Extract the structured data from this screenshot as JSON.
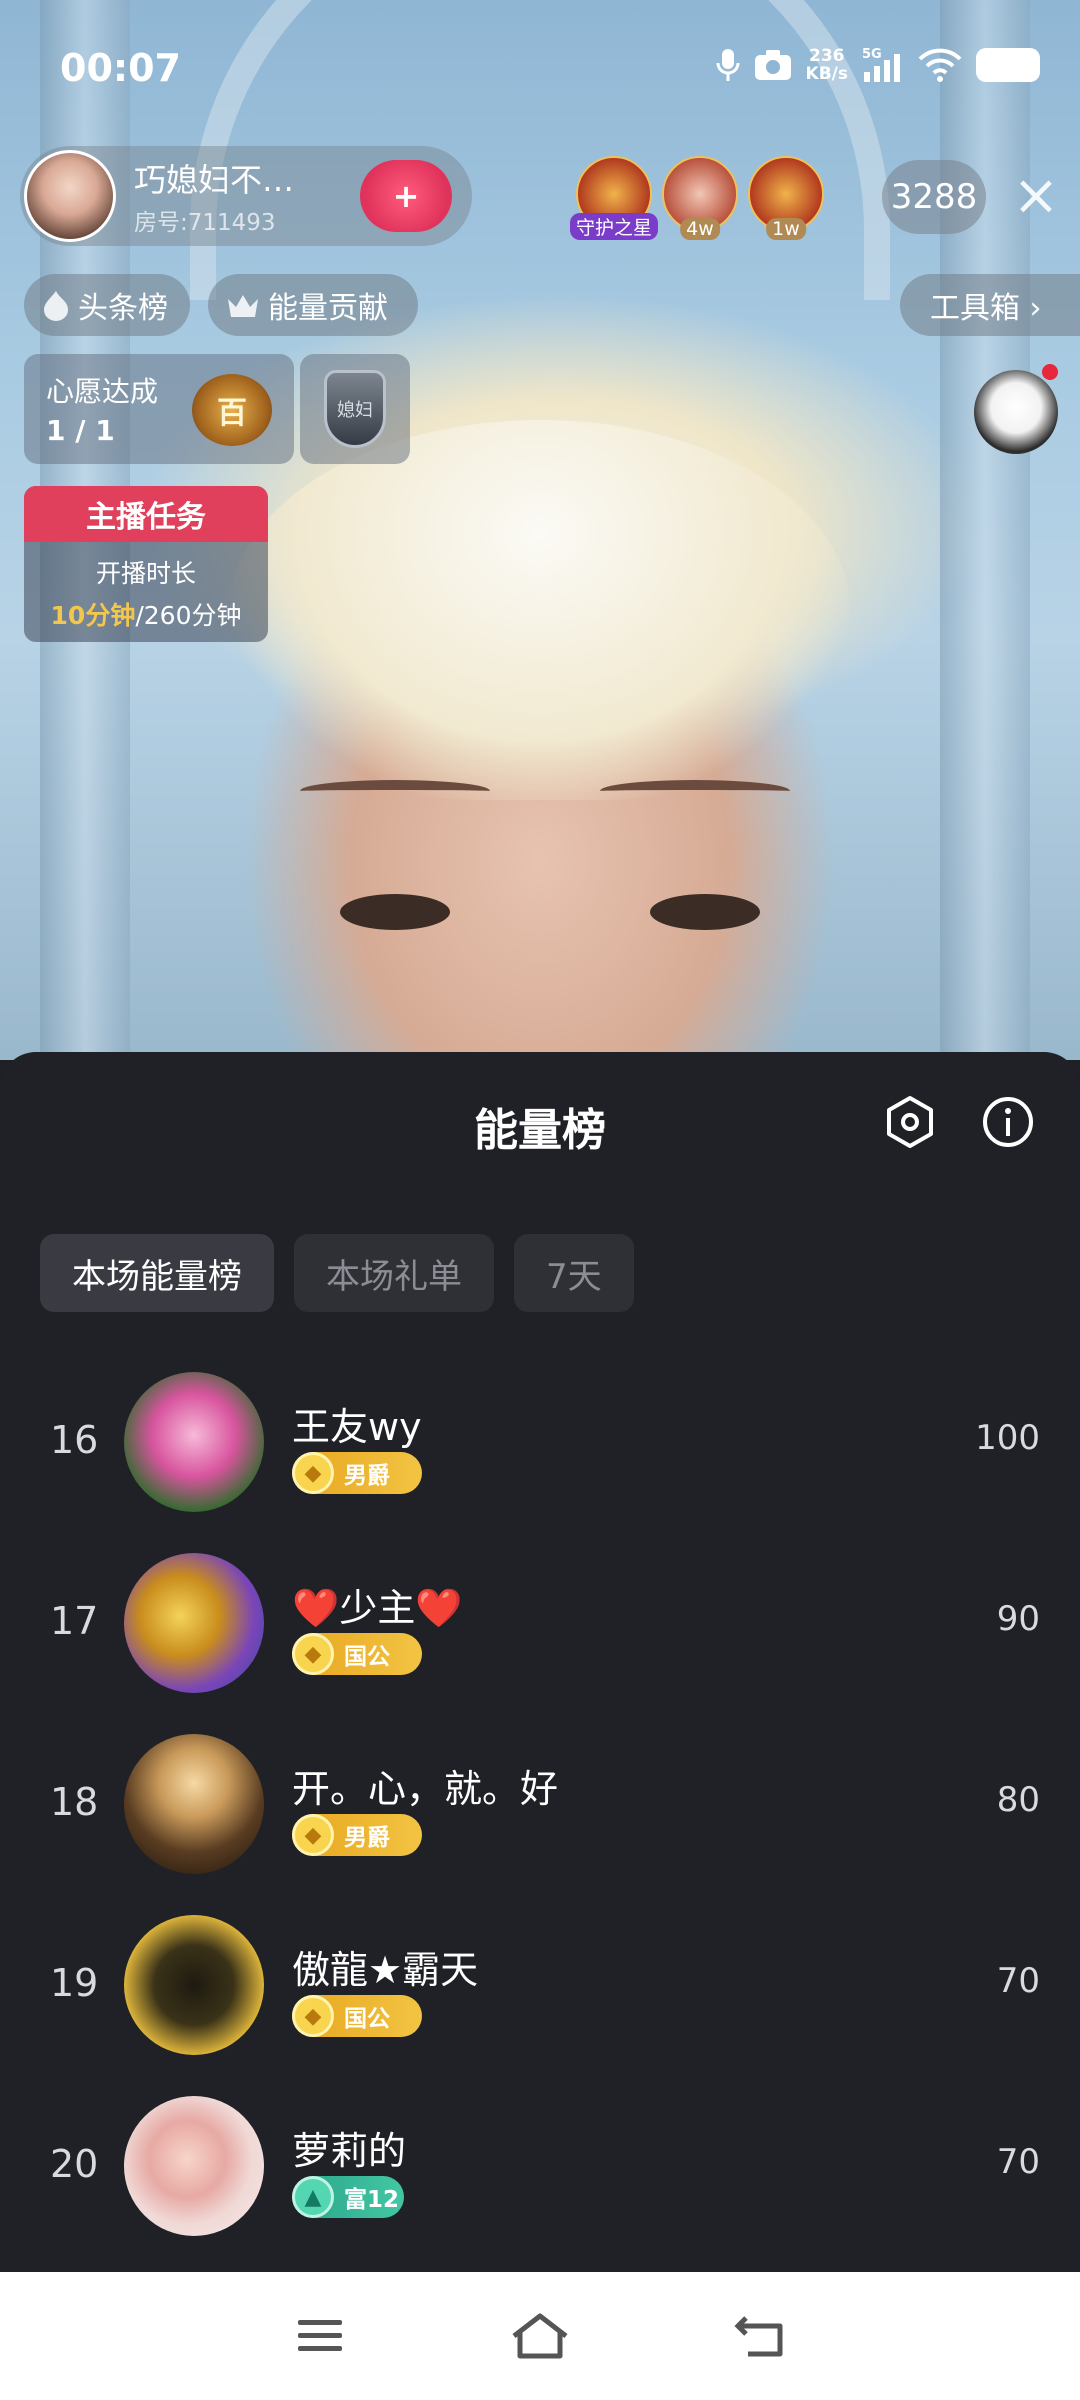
{
  "status_bar": {
    "time": "00:07",
    "net_speed_value": "236",
    "net_speed_unit": "KB/s",
    "network": "5G"
  },
  "host": {
    "name": "巧媳妇不…",
    "room": "房号:711493",
    "follow_label": "+"
  },
  "viewers": [
    {
      "tag": "守护之星",
      "color": "#7b3cc9"
    },
    {
      "tag": "4w",
      "color": "#b08a52"
    },
    {
      "tag": "1w",
      "color": "#b08a52"
    }
  ],
  "viewer_count": "3288",
  "pills": {
    "headline": "头条榜",
    "energy": "能量贡献",
    "toolbox": "工具箱 ›"
  },
  "wish": {
    "title": "心愿达成",
    "progress": "1 / 1",
    "medal": "百"
  },
  "shield_text": "媳妇",
  "task": {
    "title": "主播任务",
    "line1": "开播时长",
    "current": "10分钟",
    "total": "/260分钟"
  },
  "sheet": {
    "title": "能量榜",
    "tabs": [
      "本场能量榜",
      "本场礼单",
      "7天"
    ],
    "active_tab": 0
  },
  "ranks": [
    {
      "rank": "16",
      "name": "王友wy",
      "badge": "男爵",
      "badge_type": "gold",
      "score": "100"
    },
    {
      "rank": "17",
      "name": "❤️少主❤️",
      "badge": "国公",
      "badge_type": "gold",
      "score": "90"
    },
    {
      "rank": "18",
      "name": "开。心，就。好",
      "badge": "男爵",
      "badge_type": "gold",
      "score": "80"
    },
    {
      "rank": "19",
      "name": "傲龍★霸天",
      "badge": "国公",
      "badge_type": "gold",
      "score": "70"
    },
    {
      "rank": "20",
      "name": "萝莉的",
      "badge": "富12",
      "badge_type": "green",
      "score": "70"
    }
  ],
  "colors": {
    "sheet_bg": "#202126",
    "gold_badge": "#f2c443",
    "green_badge": "#43c7a3",
    "accent_red": "#e0405b"
  }
}
